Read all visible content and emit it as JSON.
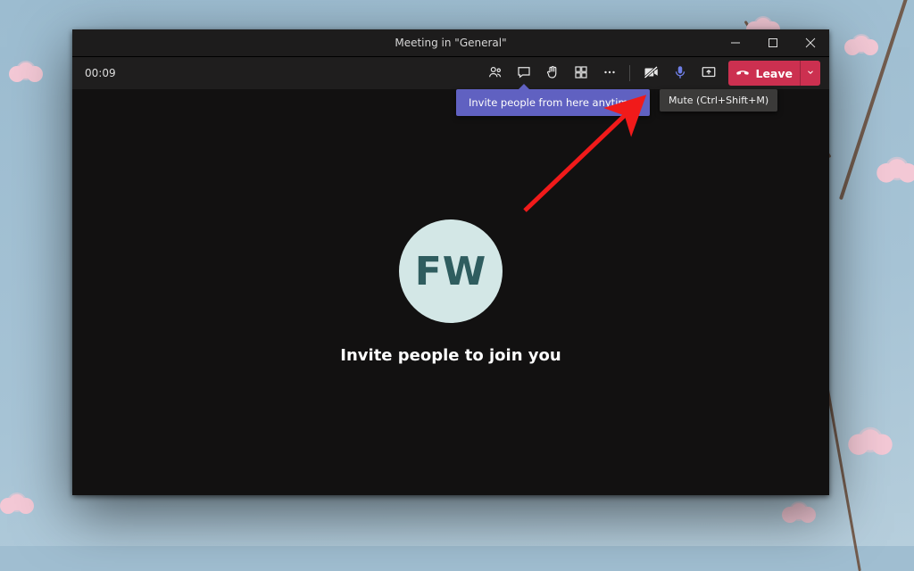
{
  "titlebar": {
    "title": "Meeting in \"General\""
  },
  "toolbar": {
    "timer": "00:09",
    "leave_label": "Leave",
    "icons": {
      "participants": "participants",
      "chat": "chat",
      "reactions": "reactions",
      "breakout": "breakout-rooms",
      "more": "more-actions",
      "camera": "camera-off",
      "mic": "microphone",
      "share": "share-screen"
    }
  },
  "tips": {
    "invite": "Invite people from here anytime.",
    "mute": "Mute (Ctrl+Shift+M)"
  },
  "main": {
    "avatar_initials": "FW",
    "heading": "Invite people to join you"
  },
  "colors": {
    "leave": "#cc3050",
    "tip_invite": "#6061c1",
    "avatar_bg": "#d3e7e6",
    "avatar_fg": "#2f5d5f",
    "mic": "#6e7ee6",
    "annotation": "#f11a1a"
  }
}
